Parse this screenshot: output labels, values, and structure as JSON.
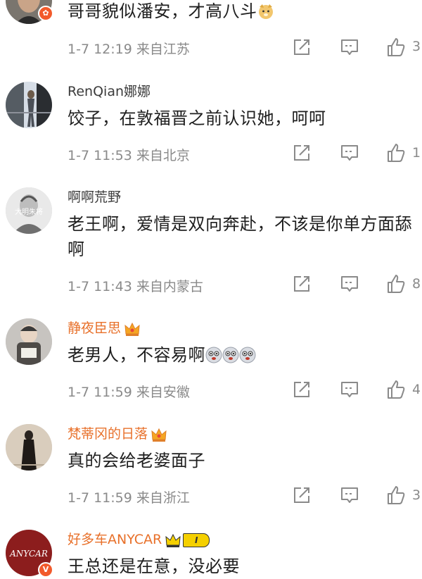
{
  "comments": [
    {
      "username": "",
      "text": "哥哥貌似潘安，才高八斗",
      "time": "1-7 12:19",
      "location": "来自江苏",
      "likes": "3"
    },
    {
      "username": "RenQian娜娜",
      "text": "饺子，在敦福晋之前认识她，呵呵",
      "time": "1-7 11:53",
      "location": "来自北京",
      "likes": "1"
    },
    {
      "username": "啊啊荒野",
      "text": "老王啊，爱情是双向奔赴，不该是你单方面舔啊",
      "time": "1-7 11:43",
      "location": "来自内蒙古",
      "likes": "8",
      "avatar_text": "大明朱将"
    },
    {
      "username": "静夜臣思",
      "text": "老男人，不容易啊",
      "time": "1-7 11:59",
      "location": "来自安徽",
      "likes": "4"
    },
    {
      "username": "梵蒂冈的日落",
      "text": "真的会给老婆面子",
      "time": "1-7 11:59",
      "location": "来自浙江",
      "likes": "3"
    },
    {
      "username": "好多车ANYCAR",
      "text": "王总还是在意，没必要",
      "avatar_text": "ANYCAR",
      "level_badge": "I"
    }
  ],
  "icons": {
    "share": "share-icon",
    "comment": "comment-icon",
    "like": "thumbs-up-icon",
    "crown": "crown-icon",
    "verified": "verified-badge-icon"
  },
  "colors": {
    "vip_name": "#e8712b",
    "meta": "#8a8a8a",
    "text": "#1e1e1e"
  }
}
